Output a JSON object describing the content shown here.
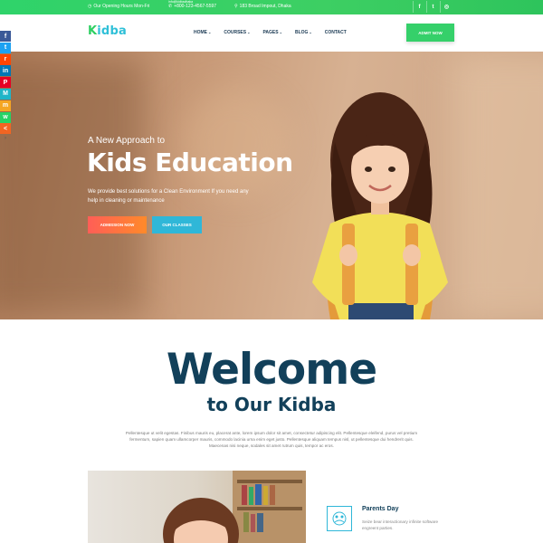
{
  "topbar": {
    "tiny_text": "info@kidbadhaka",
    "hours": "Our Opening Hours Mon-Fri",
    "phone": "+800-123-4567-5597",
    "address": "183 Broad Impout, Dhaka",
    "socials": [
      "f",
      "t",
      "◎"
    ]
  },
  "header": {
    "logo": {
      "k": "K",
      "rest": "idba"
    },
    "nav": [
      {
        "label": "HOME",
        "has_dropdown": true
      },
      {
        "label": "COURSES",
        "has_dropdown": true
      },
      {
        "label": "PAGES",
        "has_dropdown": true
      },
      {
        "label": "BLOG",
        "has_dropdown": true
      },
      {
        "label": "CONTACT",
        "has_dropdown": false
      }
    ],
    "admit_button": "ADMIT NOW"
  },
  "side_share": [
    {
      "glyph": "f",
      "color": "#3b5998"
    },
    {
      "glyph": "t",
      "color": "#1da1f2"
    },
    {
      "glyph": "r",
      "color": "#ff4500"
    },
    {
      "glyph": "in",
      "color": "#0077b5"
    },
    {
      "glyph": "P",
      "color": "#e60023"
    },
    {
      "glyph": "M",
      "color": "#1fb5c8"
    },
    {
      "glyph": "m",
      "color": "#f5a623"
    },
    {
      "glyph": "w",
      "color": "#25d366"
    },
    {
      "glyph": "<",
      "color": "#f26522"
    }
  ],
  "hero": {
    "subtitle": "A New Approach to",
    "title": "Kids Education",
    "text": "We provide best solutions for a Clean Environment If you need any help in cleaning or maintenance",
    "btn_primary": "ADMISSION NOW",
    "btn_secondary": "OUR CLASSES"
  },
  "welcome": {
    "title": "Welcome",
    "subtitle": "to Our Kidba",
    "paragraph": "Pellentesque ut velit egestas. Finibus mauris eu, placerat ante, lorem ipsum dolor sit amet, consectetur adipiscing elit. Pellentesque eleifend, purus vel pretium fermentum, sapien quam ullamcorper mauris, commodo lacinia urna enim eget justo. Pellentesque aliquam tempus nisl, ut pellentesque dui hendrerit quis. Maecenas nisi neque, sodales sit amet rutrum quis, tempor ac eros."
  },
  "feature": {
    "title": "Parents Day",
    "text": "Seize bear interactionary infinite software engreent parties."
  },
  "colors": {
    "green": "#35d06a",
    "blue": "#2fb7d8",
    "navy": "#12405a",
    "orange": "#ff8a2a"
  }
}
